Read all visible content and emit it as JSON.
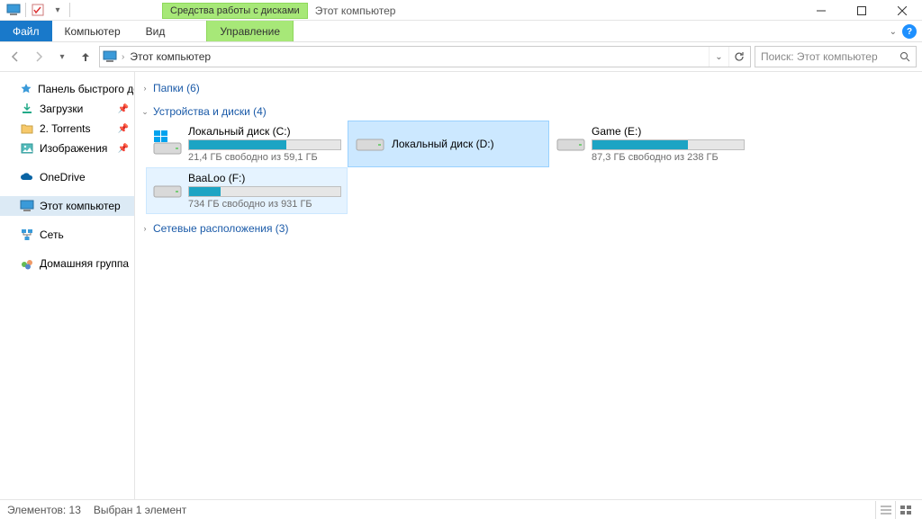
{
  "titlebar": {
    "contextual_label": "Средства работы с дисками",
    "window_title": "Этот компьютер"
  },
  "ribbon": {
    "file": "Файл",
    "computer": "Компьютер",
    "view": "Вид",
    "manage": "Управление"
  },
  "address": {
    "segment": "Этот компьютер"
  },
  "search": {
    "placeholder": "Поиск: Этот компьютер"
  },
  "sidebar": {
    "quick_access": "Панель быстрого дос",
    "downloads": "Загрузки",
    "torrents": "2. Torrents",
    "images": "Изображения",
    "onedrive": "OneDrive",
    "this_pc": "Этот компьютер",
    "network": "Сеть",
    "homegroup": "Домашняя группа"
  },
  "groups": {
    "folders": "Папки (6)",
    "devices": "Устройства и диски (4)",
    "netloc": "Сетевые расположения (3)"
  },
  "drives": [
    {
      "name": "Локальный диск (C:)",
      "free": "21,4 ГБ свободно из 59,1 ГБ",
      "fill_pct": 64,
      "has_bar": true,
      "os": true
    },
    {
      "name": "Локальный диск (D:)",
      "free": "",
      "fill_pct": 0,
      "has_bar": false,
      "selected": true
    },
    {
      "name": "Game (E:)",
      "free": "87,3 ГБ свободно из 238 ГБ",
      "fill_pct": 63,
      "has_bar": true
    },
    {
      "name": "BaaLoo (F:)",
      "free": "734 ГБ свободно из 931 ГБ",
      "fill_pct": 21,
      "has_bar": true,
      "hover": true
    }
  ],
  "status": {
    "items": "Элементов: 13",
    "selection": "Выбран 1 элемент"
  }
}
